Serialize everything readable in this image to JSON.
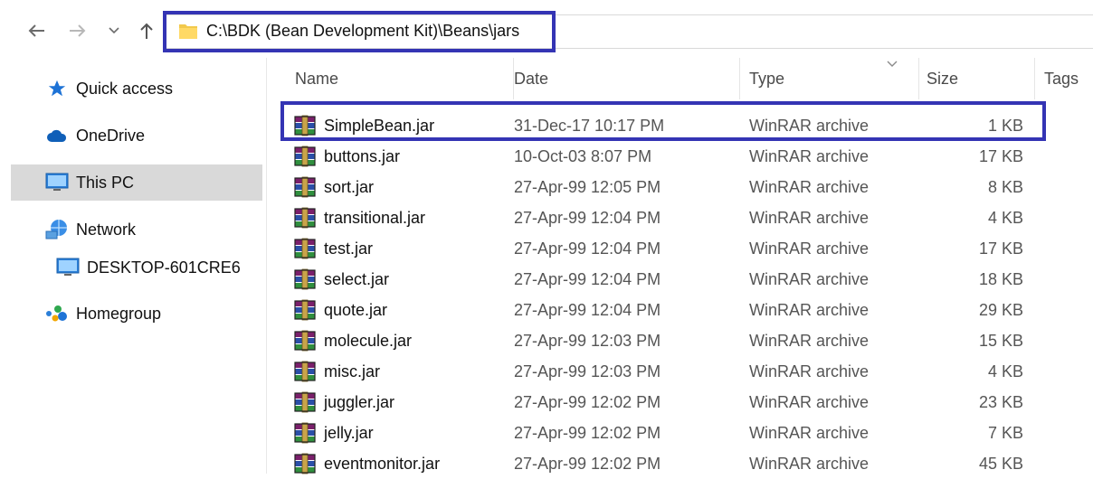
{
  "address": {
    "path": "C:\\BDK (Bean Development Kit)\\Beans\\jars"
  },
  "nav": {
    "back_icon": "arrow-left-icon",
    "forward_icon": "arrow-right-icon",
    "recent_icon": "chevron-down-icon",
    "up_icon": "arrow-up-icon"
  },
  "sidebar": {
    "items": [
      {
        "label": "Quick access",
        "icon": "star-icon"
      },
      {
        "label": "OneDrive",
        "icon": "cloud-icon"
      },
      {
        "label": "This PC",
        "icon": "monitor-icon",
        "selected": true
      },
      {
        "label": "Network",
        "icon": "network-icon"
      },
      {
        "label": "DESKTOP-601CRE6",
        "icon": "monitor-icon"
      },
      {
        "label": "Homegroup",
        "icon": "homegroup-icon"
      }
    ]
  },
  "columns": {
    "name": "Name",
    "date": "Date",
    "type": "Type",
    "size": "Size",
    "tags": "Tags"
  },
  "files": [
    {
      "name": "SimpleBean.jar",
      "date": "31-Dec-17 10:17 PM",
      "type": "WinRAR archive",
      "size": "1 KB"
    },
    {
      "name": "buttons.jar",
      "date": "10-Oct-03 8:07 PM",
      "type": "WinRAR archive",
      "size": "17 KB"
    },
    {
      "name": "sort.jar",
      "date": "27-Apr-99 12:05 PM",
      "type": "WinRAR archive",
      "size": "8 KB"
    },
    {
      "name": "transitional.jar",
      "date": "27-Apr-99 12:04 PM",
      "type": "WinRAR archive",
      "size": "4 KB"
    },
    {
      "name": "test.jar",
      "date": "27-Apr-99 12:04 PM",
      "type": "WinRAR archive",
      "size": "17 KB"
    },
    {
      "name": "select.jar",
      "date": "27-Apr-99 12:04 PM",
      "type": "WinRAR archive",
      "size": "18 KB"
    },
    {
      "name": "quote.jar",
      "date": "27-Apr-99 12:04 PM",
      "type": "WinRAR archive",
      "size": "29 KB"
    },
    {
      "name": "molecule.jar",
      "date": "27-Apr-99 12:03 PM",
      "type": "WinRAR archive",
      "size": "15 KB"
    },
    {
      "name": "misc.jar",
      "date": "27-Apr-99 12:03 PM",
      "type": "WinRAR archive",
      "size": "4 KB"
    },
    {
      "name": "juggler.jar",
      "date": "27-Apr-99 12:02 PM",
      "type": "WinRAR archive",
      "size": "23 KB"
    },
    {
      "name": "jelly.jar",
      "date": "27-Apr-99 12:02 PM",
      "type": "WinRAR archive",
      "size": "7 KB"
    },
    {
      "name": "eventmonitor.jar",
      "date": "27-Apr-99 12:02 PM",
      "type": "WinRAR archive",
      "size": "45 KB"
    }
  ],
  "colors": {
    "highlight": "#3434b4",
    "selected_bg": "#d9d9d9"
  }
}
